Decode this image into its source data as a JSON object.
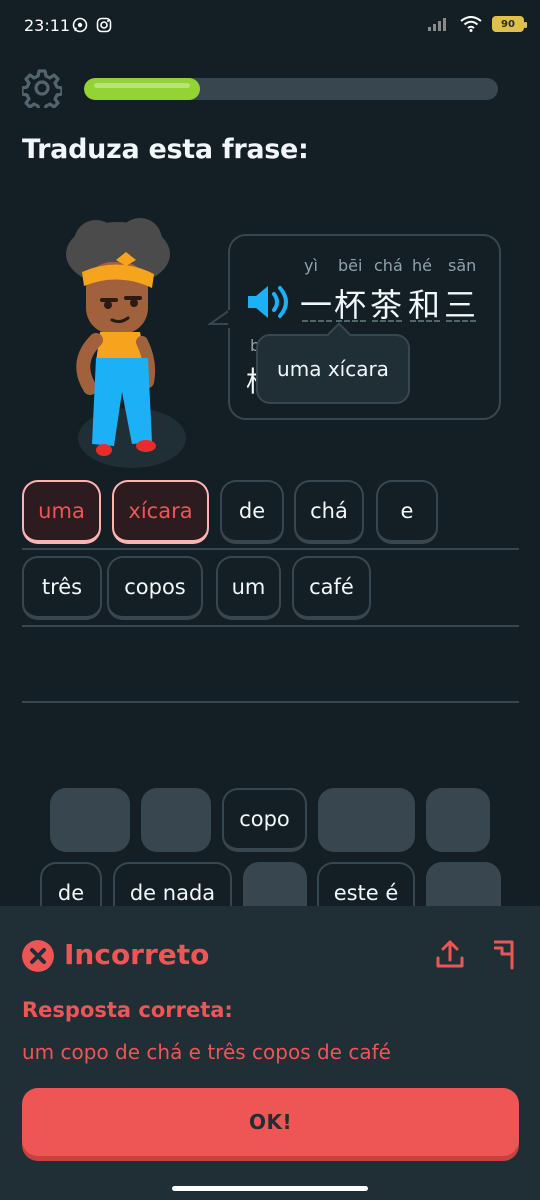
{
  "status_bar": {
    "time": "23:11",
    "battery": "90",
    "icons": [
      "whatsapp-icon",
      "instagram-icon",
      "signal-icon",
      "wifi-icon",
      "battery-icon"
    ]
  },
  "header": {
    "settings_icon": "gear-icon",
    "progress_fraction": 0.28
  },
  "prompt": {
    "title": "Traduza esta frase:"
  },
  "sentence": {
    "speaker_icon": "speaker-icon",
    "words": [
      {
        "pinyin": "yì",
        "hanzi": "一"
      },
      {
        "pinyin": "bēi",
        "hanzi": "杯"
      },
      {
        "pinyin": "chá",
        "hanzi": "茶"
      },
      {
        "pinyin": "hé",
        "hanzi": "和"
      },
      {
        "pinyin": "sān",
        "hanzi": "三"
      }
    ],
    "partial_second_line": {
      "pinyin": "b",
      "hanzi": "杯"
    },
    "tooltip": "uma xícara"
  },
  "answer": {
    "chips": [
      {
        "label": "uma",
        "state": "wrong"
      },
      {
        "label": "xícara",
        "state": "wrong"
      },
      {
        "label": "de",
        "state": "normal"
      },
      {
        "label": "chá",
        "state": "normal"
      },
      {
        "label": "e",
        "state": "normal"
      },
      {
        "label": "três",
        "state": "normal"
      },
      {
        "label": "copos",
        "state": "normal"
      },
      {
        "label": "um",
        "state": "normal"
      },
      {
        "label": "café",
        "state": "normal"
      }
    ]
  },
  "word_bank": {
    "chips": [
      {
        "label": "",
        "state": "used"
      },
      {
        "label": "",
        "state": "used"
      },
      {
        "label": "copo",
        "state": "available"
      },
      {
        "label": "",
        "state": "used"
      },
      {
        "label": "",
        "state": "used"
      },
      {
        "label": "de",
        "state": "available"
      },
      {
        "label": "de nada",
        "state": "available"
      },
      {
        "label": "",
        "state": "used"
      },
      {
        "label": "este é",
        "state": "available"
      },
      {
        "label": "",
        "state": "used"
      }
    ]
  },
  "feedback": {
    "title": "Incorreto",
    "correct_label": "Resposta correta:",
    "correct_answer": "um copo de chá e três copos de café",
    "button": "OK!",
    "accent": "#ee5555"
  }
}
